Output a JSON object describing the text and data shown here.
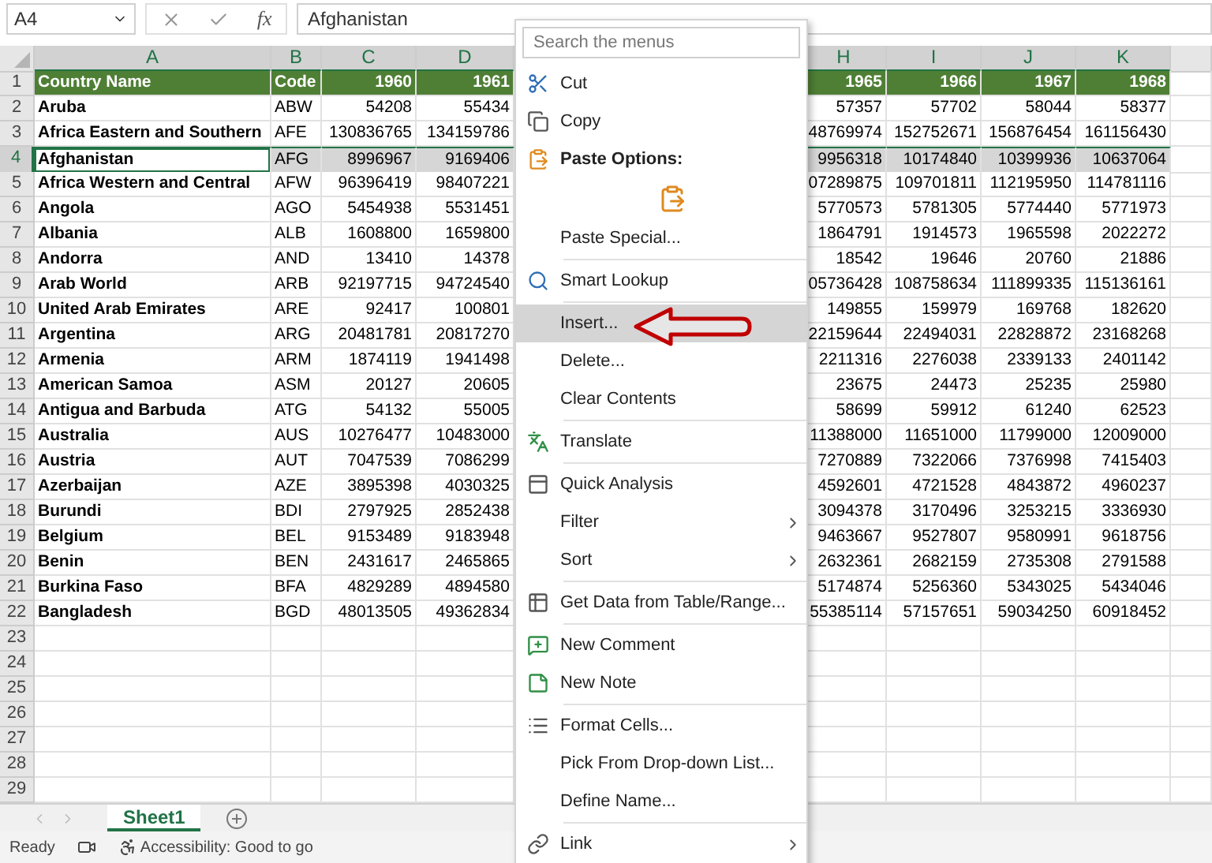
{
  "formula_bar": {
    "name_box": "A4",
    "function_label": "fx",
    "formula": "Afghanistan"
  },
  "columns": [
    {
      "label": "A",
      "selected": true
    },
    {
      "label": "B",
      "selected": true
    },
    {
      "label": "C",
      "selected": true
    },
    {
      "label": "D",
      "selected": true
    },
    {
      "label": "H",
      "selected": true
    },
    {
      "label": "I",
      "selected": true
    },
    {
      "label": "J",
      "selected": true
    },
    {
      "label": "K",
      "selected": true
    }
  ],
  "rows": [
    {
      "num": "1",
      "kind": "header",
      "selected": false,
      "cells": [
        "Country Name",
        "Code",
        "1960",
        "1961",
        "1965",
        "1966",
        "1967",
        "1968"
      ]
    },
    {
      "num": "2",
      "kind": "data",
      "selected": false,
      "cells": [
        "Aruba",
        "ABW",
        "54208",
        "55434",
        "57357",
        "57702",
        "58044",
        "58377"
      ]
    },
    {
      "num": "3",
      "kind": "data",
      "selected": false,
      "cells": [
        "Africa Eastern and Southern",
        "AFE",
        "130836765",
        "134159786",
        "48769974",
        "152752671",
        "156876454",
        "161156430"
      ]
    },
    {
      "num": "4",
      "kind": "data",
      "selected": true,
      "cells": [
        "Afghanistan",
        "AFG",
        "8996967",
        "9169406",
        "9956318",
        "10174840",
        "10399936",
        "10637064"
      ]
    },
    {
      "num": "5",
      "kind": "data",
      "selected": false,
      "cells": [
        "Africa Western and Central",
        "AFW",
        "96396419",
        "98407221",
        "07289875",
        "109701811",
        "112195950",
        "114781116"
      ]
    },
    {
      "num": "6",
      "kind": "data",
      "selected": false,
      "cells": [
        "Angola",
        "AGO",
        "5454938",
        "5531451",
        "5770573",
        "5781305",
        "5774440",
        "5771973"
      ]
    },
    {
      "num": "7",
      "kind": "data",
      "selected": false,
      "cells": [
        "Albania",
        "ALB",
        "1608800",
        "1659800",
        "1864791",
        "1914573",
        "1965598",
        "2022272"
      ]
    },
    {
      "num": "8",
      "kind": "data",
      "selected": false,
      "cells": [
        "Andorra",
        "AND",
        "13410",
        "14378",
        "18542",
        "19646",
        "20760",
        "21886"
      ]
    },
    {
      "num": "9",
      "kind": "data",
      "selected": false,
      "cells": [
        "Arab World",
        "ARB",
        "92197715",
        "94724540",
        "05736428",
        "108758634",
        "111899335",
        "115136161"
      ]
    },
    {
      "num": "10",
      "kind": "data",
      "selected": false,
      "cells": [
        "United Arab Emirates",
        "ARE",
        "92417",
        "100801",
        "149855",
        "159979",
        "169768",
        "182620"
      ]
    },
    {
      "num": "11",
      "kind": "data",
      "selected": false,
      "cells": [
        "Argentina",
        "ARG",
        "20481781",
        "20817270",
        "22159644",
        "22494031",
        "22828872",
        "23168268"
      ]
    },
    {
      "num": "12",
      "kind": "data",
      "selected": false,
      "cells": [
        "Armenia",
        "ARM",
        "1874119",
        "1941498",
        "2211316",
        "2276038",
        "2339133",
        "2401142"
      ]
    },
    {
      "num": "13",
      "kind": "data",
      "selected": false,
      "cells": [
        "American Samoa",
        "ASM",
        "20127",
        "20605",
        "23675",
        "24473",
        "25235",
        "25980"
      ]
    },
    {
      "num": "14",
      "kind": "data",
      "selected": false,
      "cells": [
        "Antigua and Barbuda",
        "ATG",
        "54132",
        "55005",
        "58699",
        "59912",
        "61240",
        "62523"
      ]
    },
    {
      "num": "15",
      "kind": "data",
      "selected": false,
      "cells": [
        "Australia",
        "AUS",
        "10276477",
        "10483000",
        "11388000",
        "11651000",
        "11799000",
        "12009000"
      ]
    },
    {
      "num": "16",
      "kind": "data",
      "selected": false,
      "cells": [
        "Austria",
        "AUT",
        "7047539",
        "7086299",
        "7270889",
        "7322066",
        "7376998",
        "7415403"
      ]
    },
    {
      "num": "17",
      "kind": "data",
      "selected": false,
      "cells": [
        "Azerbaijan",
        "AZE",
        "3895398",
        "4030325",
        "4592601",
        "4721528",
        "4843872",
        "4960237"
      ]
    },
    {
      "num": "18",
      "kind": "data",
      "selected": false,
      "cells": [
        "Burundi",
        "BDI",
        "2797925",
        "2852438",
        "3094378",
        "3170496",
        "3253215",
        "3336930"
      ]
    },
    {
      "num": "19",
      "kind": "data",
      "selected": false,
      "cells": [
        "Belgium",
        "BEL",
        "9153489",
        "9183948",
        "9463667",
        "9527807",
        "9580991",
        "9618756"
      ]
    },
    {
      "num": "20",
      "kind": "data",
      "selected": false,
      "cells": [
        "Benin",
        "BEN",
        "2431617",
        "2465865",
        "2632361",
        "2682159",
        "2735308",
        "2791588"
      ]
    },
    {
      "num": "21",
      "kind": "data",
      "selected": false,
      "cells": [
        "Burkina Faso",
        "BFA",
        "4829289",
        "4894580",
        "5174874",
        "5256360",
        "5343025",
        "5434046"
      ]
    },
    {
      "num": "22",
      "kind": "data",
      "selected": false,
      "cells": [
        "Bangladesh",
        "BGD",
        "48013505",
        "49362834",
        "55385114",
        "57157651",
        "59034250",
        "60918452"
      ]
    },
    {
      "num": "23",
      "kind": "empty",
      "selected": false,
      "cells": []
    },
    {
      "num": "24",
      "kind": "empty",
      "selected": false,
      "cells": []
    },
    {
      "num": "25",
      "kind": "empty",
      "selected": false,
      "cells": []
    },
    {
      "num": "26",
      "kind": "empty",
      "selected": false,
      "cells": []
    },
    {
      "num": "27",
      "kind": "empty",
      "selected": false,
      "cells": []
    },
    {
      "num": "28",
      "kind": "empty",
      "selected": false,
      "cells": []
    },
    {
      "num": "29",
      "kind": "empty",
      "selected": false,
      "cells": []
    }
  ],
  "context_menu": {
    "search": {
      "placeholder": "Search the menus"
    },
    "items": [
      {
        "kind": "item",
        "label": "Cut",
        "selected": false
      },
      {
        "kind": "item",
        "label": "Copy",
        "selected": false
      },
      {
        "kind": "header",
        "label": "Paste Options:",
        "selected": false
      },
      {
        "kind": "paste-option",
        "selected": false
      },
      {
        "kind": "item",
        "label": "Paste Special...",
        "selected": false
      },
      {
        "kind": "separator"
      },
      {
        "kind": "item",
        "label": "Smart Lookup",
        "selected": false
      },
      {
        "kind": "separator"
      },
      {
        "kind": "item",
        "label": "Insert...",
        "selected": true
      },
      {
        "kind": "item",
        "label": "Delete...",
        "selected": false
      },
      {
        "kind": "item",
        "label": "Clear Contents",
        "selected": false
      },
      {
        "kind": "separator"
      },
      {
        "kind": "item",
        "label": "Translate",
        "selected": false
      },
      {
        "kind": "separator"
      },
      {
        "kind": "item",
        "label": "Quick Analysis",
        "selected": false
      },
      {
        "kind": "item",
        "label": "Filter",
        "selected": false,
        "submenu": true
      },
      {
        "kind": "item",
        "label": "Sort",
        "selected": false,
        "submenu": true
      },
      {
        "kind": "separator"
      },
      {
        "kind": "item",
        "label": "Get Data from Table/Range...",
        "selected": false
      },
      {
        "kind": "separator"
      },
      {
        "kind": "item",
        "label": "New Comment",
        "selected": false
      },
      {
        "kind": "item",
        "label": "New Note",
        "selected": false
      },
      {
        "kind": "separator"
      },
      {
        "kind": "item",
        "label": "Format Cells...",
        "selected": false
      },
      {
        "kind": "item",
        "label": "Pick From Drop-down List...",
        "selected": false
      },
      {
        "kind": "item",
        "label": "Define Name...",
        "selected": false
      },
      {
        "kind": "separator"
      },
      {
        "kind": "item",
        "label": "Link",
        "selected": false,
        "submenu": true
      }
    ]
  },
  "callout": {
    "kind": "arrow"
  },
  "sheet_tabs": [
    {
      "label": "Sheet1",
      "selected": true
    }
  ],
  "status_bar": {
    "mode": "Ready",
    "accessibility": "Accessibility: Good to go"
  }
}
